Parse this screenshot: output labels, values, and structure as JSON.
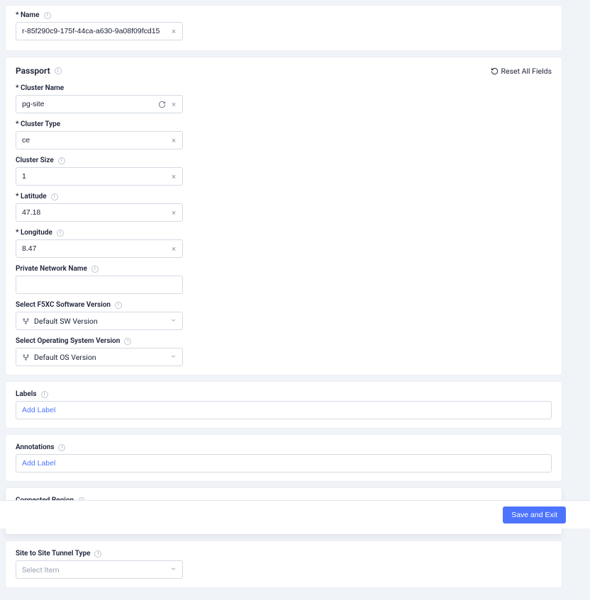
{
  "name": {
    "label": "* Name",
    "value": "r-85f290c9-175f-44ca-a630-9a08f09fcd15"
  },
  "passport": {
    "title": "Passport",
    "reset_label": "Reset All Fields",
    "cluster_name": {
      "label": "* Cluster Name",
      "value": "pg-site"
    },
    "cluster_type": {
      "label": "* Cluster Type",
      "value": "ce"
    },
    "cluster_size": {
      "label": "Cluster Size",
      "value": "1"
    },
    "latitude": {
      "label": "* Latitude",
      "value": "47.18"
    },
    "longitude": {
      "label": "* Longitude",
      "value": "8.47"
    },
    "private_network_name": {
      "label": "Private Network Name",
      "value": ""
    },
    "software_version": {
      "label": "Select F5XC Software Version",
      "value": "Default SW Version"
    },
    "os_version": {
      "label": "Select Operating System Version",
      "value": "Default OS Version"
    }
  },
  "labels": {
    "label": "Labels",
    "placeholder": "Add Label"
  },
  "annotations": {
    "label": "Annotations",
    "placeholder": "Add Label"
  },
  "connected_region": {
    "label": "Connected Region",
    "value": ""
  },
  "tunnel_type": {
    "label": "Site to Site Tunnel Type",
    "placeholder": "Select Item"
  },
  "footer": {
    "save_label": "Save and Exit"
  }
}
